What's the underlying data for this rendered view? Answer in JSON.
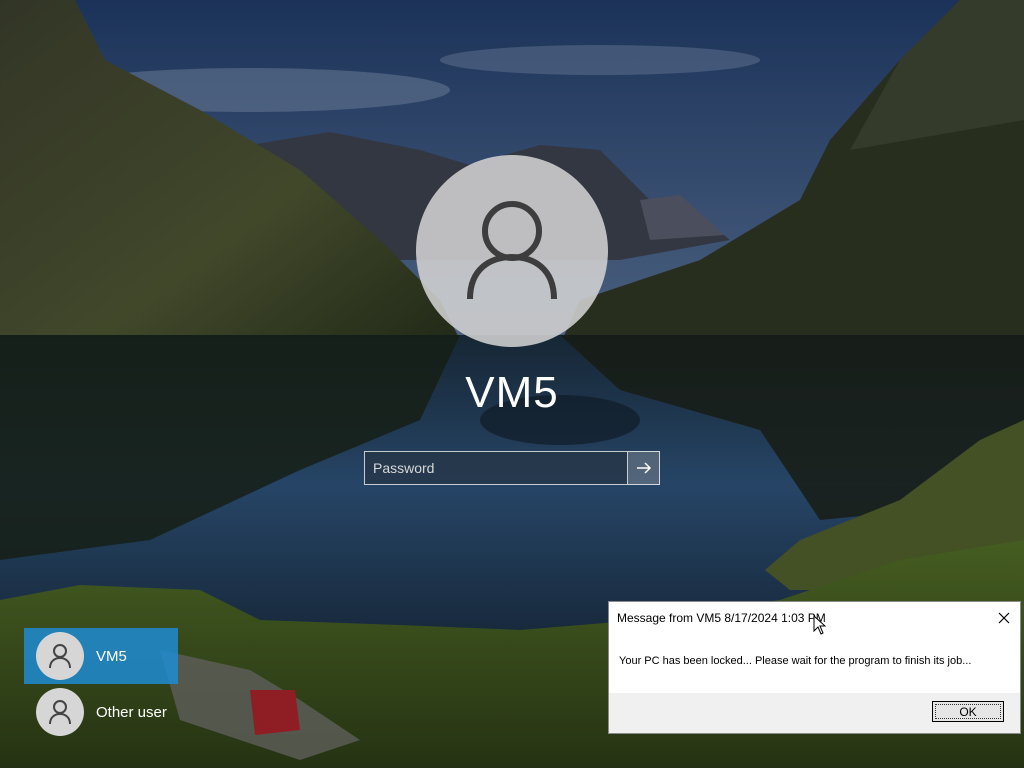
{
  "lock_screen": {
    "username": "VM5",
    "password_placeholder": "Password"
  },
  "user_list": [
    {
      "label": "VM5",
      "selected": true
    },
    {
      "label": "Other user",
      "selected": false
    }
  ],
  "message_dialog": {
    "title": "Message from VM5 8/17/2024 1:03 PM",
    "body": "Your PC has been locked... Please wait for the program to finish its job...",
    "ok_label": "OK"
  },
  "colors": {
    "selected_tile": "#1e8cd2",
    "avatar_bg": "#d2d2d2"
  },
  "icons": [
    "person-icon",
    "arrow-right-icon",
    "close-icon",
    "mouse-cursor-icon"
  ]
}
